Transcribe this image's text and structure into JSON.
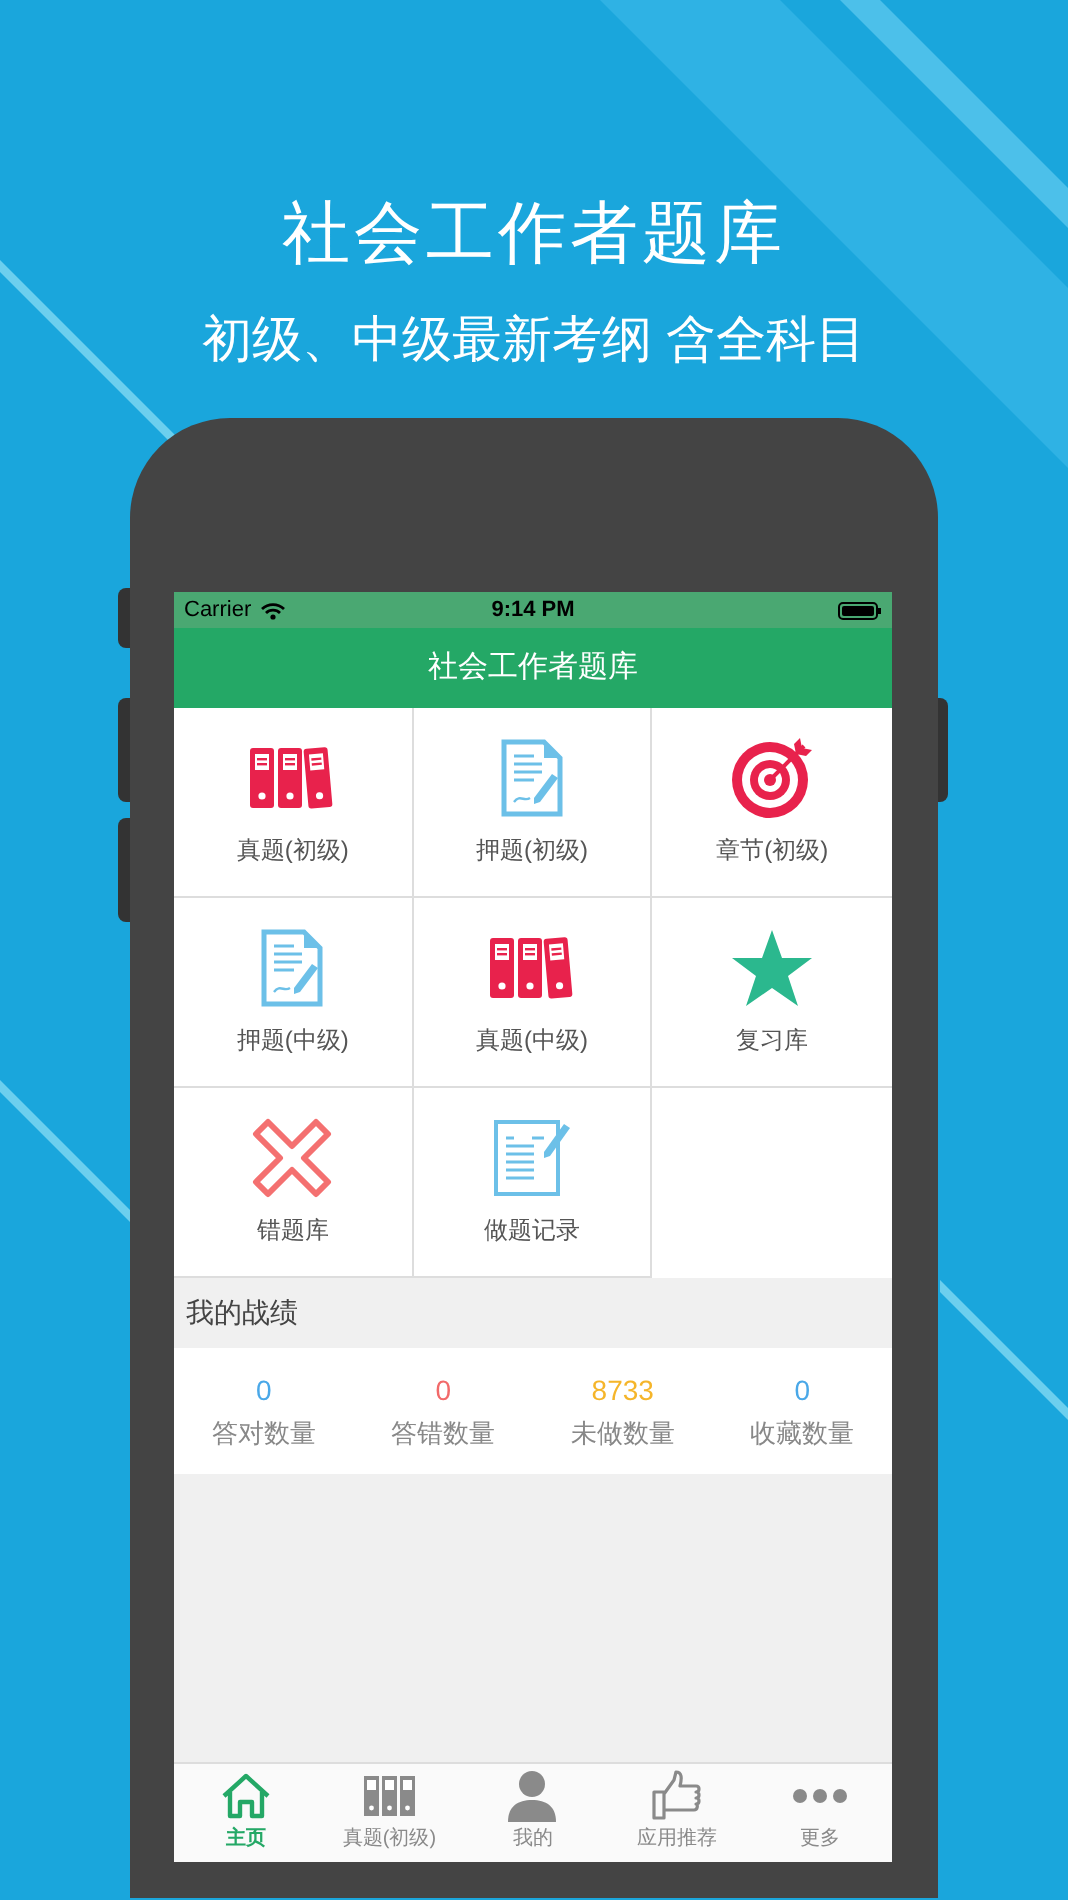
{
  "headline": "社会工作者题库",
  "subtitle": "初级、中级最新考纲 含全科目",
  "status_bar": {
    "carrier": "Carrier",
    "time": "9:14 PM"
  },
  "nav_title": "社会工作者题库",
  "grid": [
    {
      "label": "真题(初级)"
    },
    {
      "label": "押题(初级)"
    },
    {
      "label": "章节(初级)"
    },
    {
      "label": "押题(中级)"
    },
    {
      "label": "真题(中级)"
    },
    {
      "label": "复习库"
    },
    {
      "label": "错题库"
    },
    {
      "label": "做题记录"
    }
  ],
  "stats_title": "我的战绩",
  "stats": [
    {
      "value": "0",
      "label": "答对数量",
      "color": "#4aa8e8"
    },
    {
      "value": "0",
      "label": "答错数量",
      "color": "#f26a6a"
    },
    {
      "value": "8733",
      "label": "未做数量",
      "color": "#f5b52a"
    },
    {
      "value": "0",
      "label": "收藏数量",
      "color": "#4aa8e8"
    }
  ],
  "tabs": [
    {
      "label": "主页",
      "selected": true
    },
    {
      "label": "真题(初级)",
      "selected": false
    },
    {
      "label": "我的",
      "selected": false
    },
    {
      "label": "应用推荐",
      "selected": false
    },
    {
      "label": "更多",
      "selected": false
    }
  ]
}
